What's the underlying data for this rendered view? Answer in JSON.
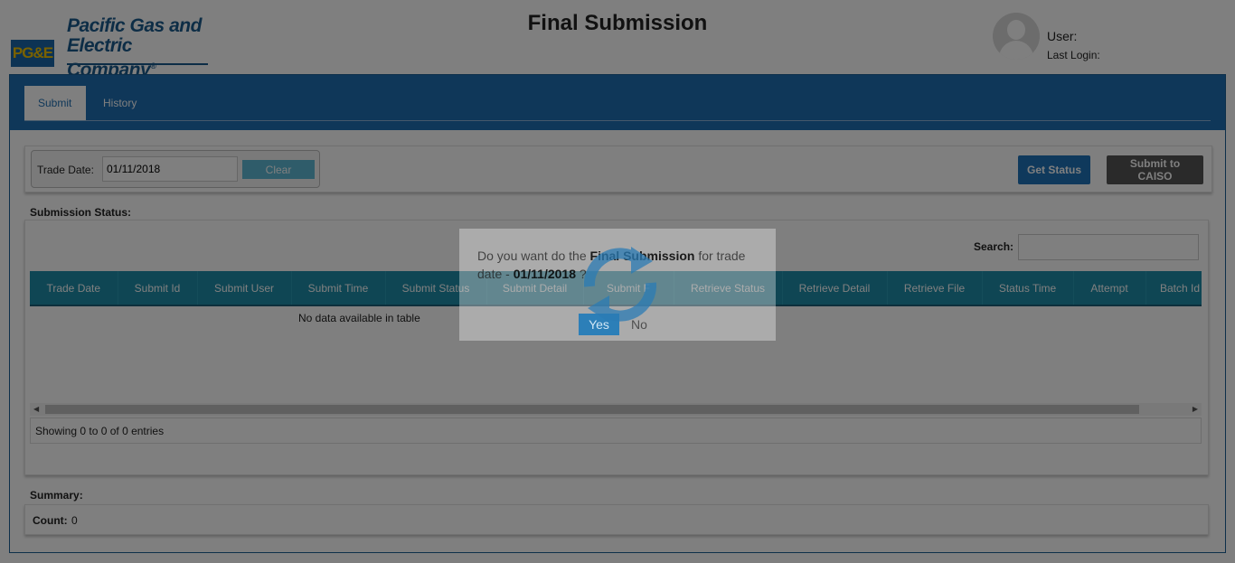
{
  "header": {
    "logo_mark": "PG&E",
    "company_line1": "Pacific Gas and",
    "company_line2": "Electric Company",
    "page_title": "Final Submission",
    "user_label": "User:",
    "last_login_label": "Last Login:"
  },
  "tabs": [
    {
      "label": "Submit",
      "active": true
    },
    {
      "label": "History",
      "active": false
    }
  ],
  "filter": {
    "trade_date_label": "Trade Date:",
    "trade_date_value": "01/11/2018",
    "clear_label": "Clear",
    "get_status_label": "Get Status",
    "submit_caiso_label": "Submit to CAISO"
  },
  "submission": {
    "section_label": "Submission Status:",
    "search_label": "Search:",
    "search_value": "",
    "columns": [
      "Trade Date",
      "Submit Id",
      "Submit User",
      "Submit Time",
      "Submit Status",
      "Submit Detail",
      "Submit F",
      "Retrieve Status",
      "Retrieve Detail",
      "Retrieve File",
      "Status Time",
      "Attempt",
      "Batch Id"
    ],
    "empty_message": "No data available in table",
    "info": "Showing 0 to 0 of 0 entries"
  },
  "summary": {
    "section_label": "Summary:",
    "count_label": "Count:",
    "count_value": "0"
  },
  "dialog": {
    "text_pre": "Do you want do the ",
    "text_bold": "Final Submission",
    "text_mid": " for trade date - ",
    "text_date": "01/11/2018",
    "text_post": " ?",
    "yes_label": "Yes",
    "no_label": "No"
  },
  "colors": {
    "brand_blue": "#1f6fb2",
    "table_header": "#1f8ca8",
    "clear_button": "#5eb9d4",
    "status_button": "#1f73b8",
    "caiso_button": "#555555"
  },
  "icons": [
    "user-avatar-icon",
    "refresh-spinner-icon",
    "scroll-left-icon",
    "scroll-right-icon"
  ]
}
